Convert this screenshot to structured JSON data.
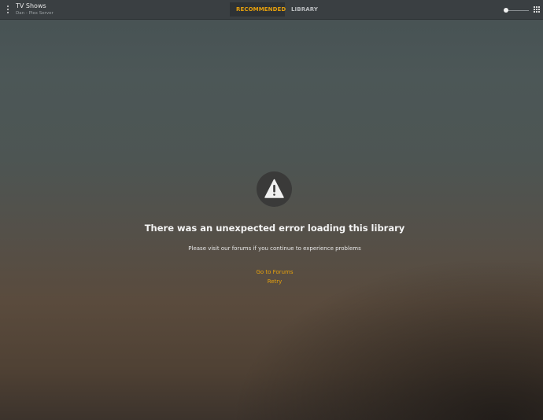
{
  "header": {
    "title": "TV Shows",
    "subtitle": "Dan - Plex Server",
    "tabs": [
      {
        "label": "RECOMMENDED",
        "active": true
      },
      {
        "label": "LIBRARY",
        "active": false
      }
    ],
    "accent_color": "#e5a00d"
  },
  "icons": {
    "menu": "more-vertical-icon",
    "size": "size-slider",
    "view": "grid-view-icon",
    "error": "warning-icon"
  },
  "error": {
    "title": "There was an unexpected error loading this library",
    "message": "Please visit our forums if you continue to experience problems",
    "links": {
      "forums": "Go to Forums",
      "retry": "Retry"
    }
  }
}
